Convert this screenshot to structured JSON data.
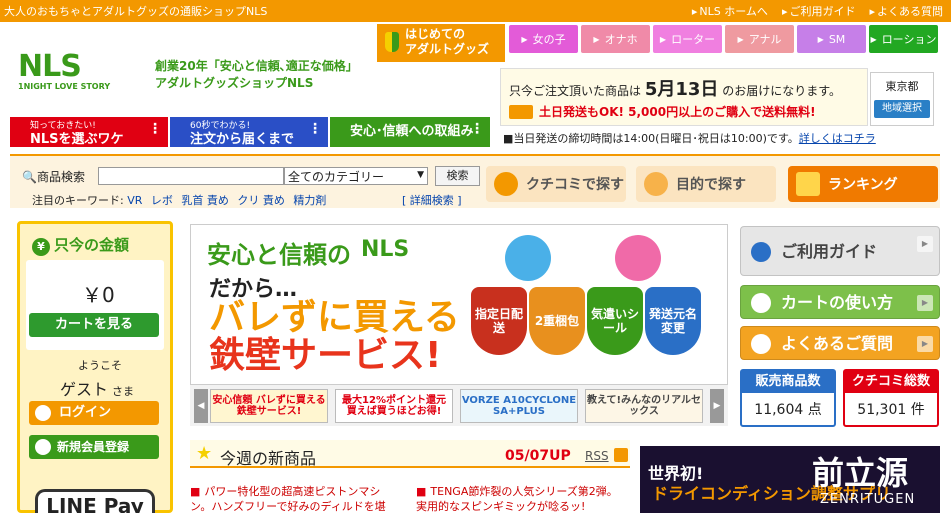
{
  "topbar": {
    "tagline": "大人のおもちゃとアダルトグッズの通販ショップNLS",
    "links": [
      "NLS ホームへ",
      "ご利用ガイド",
      "よくある質問"
    ]
  },
  "logo": {
    "text": "NLS",
    "sub": "1NIGHT LOVE STORY"
  },
  "catch": {
    "line1": "創業20年「安心と信頼､適正な価格」",
    "line2": "アダルトグッズショップNLS"
  },
  "hajimete": {
    "line1": "はじめての",
    "line2": "アダルトグッズ"
  },
  "categories": [
    {
      "label": "女の子",
      "color": "#e35bd8"
    },
    {
      "label": "オナホ",
      "color": "#f08aa8"
    },
    {
      "label": "ローター",
      "color": "#f07fe0"
    },
    {
      "label": "アナル",
      "color": "#ef9aa0"
    },
    {
      "label": "SM",
      "color": "#c67fe8"
    },
    {
      "label": "ローション",
      "color": "#22a822"
    }
  ],
  "delivery": {
    "pre": "只今ご注文頂いた商品は",
    "date": "5月13日",
    "post": "のお届けになります。",
    "free": "土日発送もOK! 5,000円以上のご購入で送料無料!"
  },
  "region": {
    "name": "東京都",
    "button": "地域選択"
  },
  "featureTabs": [
    {
      "small": "知っておきたい!",
      "label": "NLSを選ぶワケ",
      "color": "#e00012"
    },
    {
      "small": "60秒でわかる!",
      "label": "注文から届くまで",
      "color": "#2a4fc6"
    },
    {
      "small": "",
      "label": "安心･信頼への取組み",
      "color": "#3a9a1a"
    }
  ],
  "shime": {
    "text": "■当日発送の締切時間は14:00(日曜日･祝日は10:00)です。",
    "link": "詳しくはコチラ"
  },
  "search": {
    "label": "商品検索",
    "select": "全てのカテゴリー",
    "button": "検索",
    "kwLabel": "注目のキーワード:",
    "keywords": [
      "VR",
      "レボ",
      "乳首 責め",
      "クリ 責め",
      "精力剤"
    ],
    "detail": "詳細検索"
  },
  "bigButtons": {
    "kuchikomi": "クチコミで探す",
    "mokuteki": "目的で探す",
    "ranking": "ランキング"
  },
  "cart": {
    "title": "只今の金額",
    "amount": "￥0",
    "view": "カートを見る",
    "welcome": "ようこそ",
    "guest": "ゲスト",
    "sama": "さま",
    "login": "ログイン",
    "register": "新規会員登録",
    "linepay": "LINE Pay"
  },
  "banner": {
    "t1": "安心と信頼の",
    "logo": "NLS",
    "t2": "だから…",
    "t3": "バレずに買える",
    "t4": "鉄壁サービス!",
    "shields": [
      "指定日配送",
      "2重梱包",
      "気遣いシール",
      "発送元名変更"
    ]
  },
  "thumbs": [
    "安心信頼 バレずに買える鉄壁サービス!",
    "最大12%ポイント還元 買えば買うほどお得!",
    "VORZE A10CYCLONE SA+PLUS",
    "教えて!みんなのリアルセックス"
  ],
  "right": {
    "guide": "ご利用ガイド",
    "cartHow": "カートの使い方",
    "faq": "よくあるご質問",
    "statItems": "販売商品数",
    "statItemsVal": "11,604 点",
    "statReviews": "クチコミ総数",
    "statReviewsVal": "51,301 件"
  },
  "newItems": {
    "title": "今週の新商品",
    "date": "05/07UP",
    "rss": "RSS",
    "items": [
      "パワー特化型の超高速ピストンマシン。ハンズフリーで好みのディルドを堪",
      "TENGA節炸裂の人気シリーズ第2弾。実用的なスピンギミックが唸るッ!"
    ]
  },
  "zbanner": {
    "z1": "世界初!",
    "z2": "ドライコンディション調整サプリ",
    "z3": "前立源",
    "z4": "ZENRITUGEN"
  }
}
